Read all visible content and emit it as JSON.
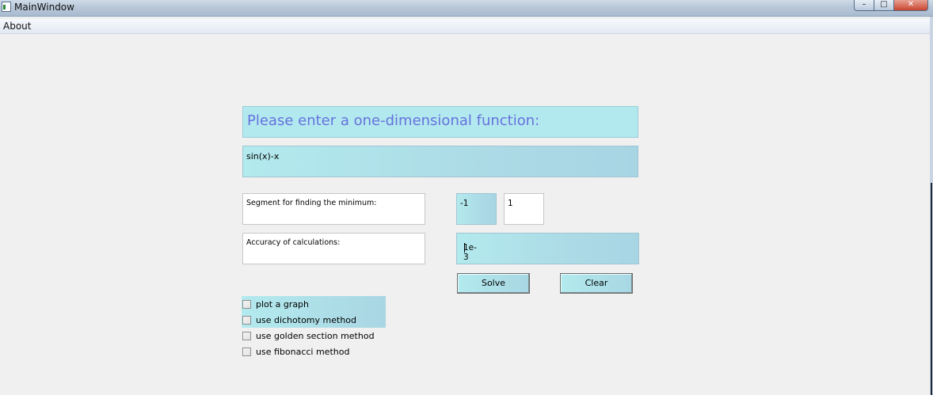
{
  "window": {
    "title": "MainWindow",
    "controls": {
      "minimize": "–",
      "maximize": "□",
      "close": "✕"
    }
  },
  "menu": {
    "items": [
      {
        "label": "About"
      }
    ]
  },
  "heading": "Please enter a one-dimensional function:",
  "function_input": {
    "value": "sin(x)-x"
  },
  "segment": {
    "label": "Segment for finding the minimum:",
    "left_value": "-1",
    "right_value": "1"
  },
  "accuracy": {
    "label": "Accuracy of calculations:",
    "value": "1e-3"
  },
  "buttons": {
    "solve": "Solve",
    "clear": "Clear"
  },
  "options": [
    {
      "label": "plot a graph",
      "checked": false
    },
    {
      "label": "use dichotomy method",
      "checked": false
    },
    {
      "label": "use golden section method",
      "checked": false
    },
    {
      "label": "use fibonacci method",
      "checked": false
    }
  ],
  "colors": {
    "heading_text": "#6672dc",
    "field_accent": "#b3eaee",
    "background": "#f0f0f0"
  },
  "icons": {
    "app": "app-window-icon"
  }
}
